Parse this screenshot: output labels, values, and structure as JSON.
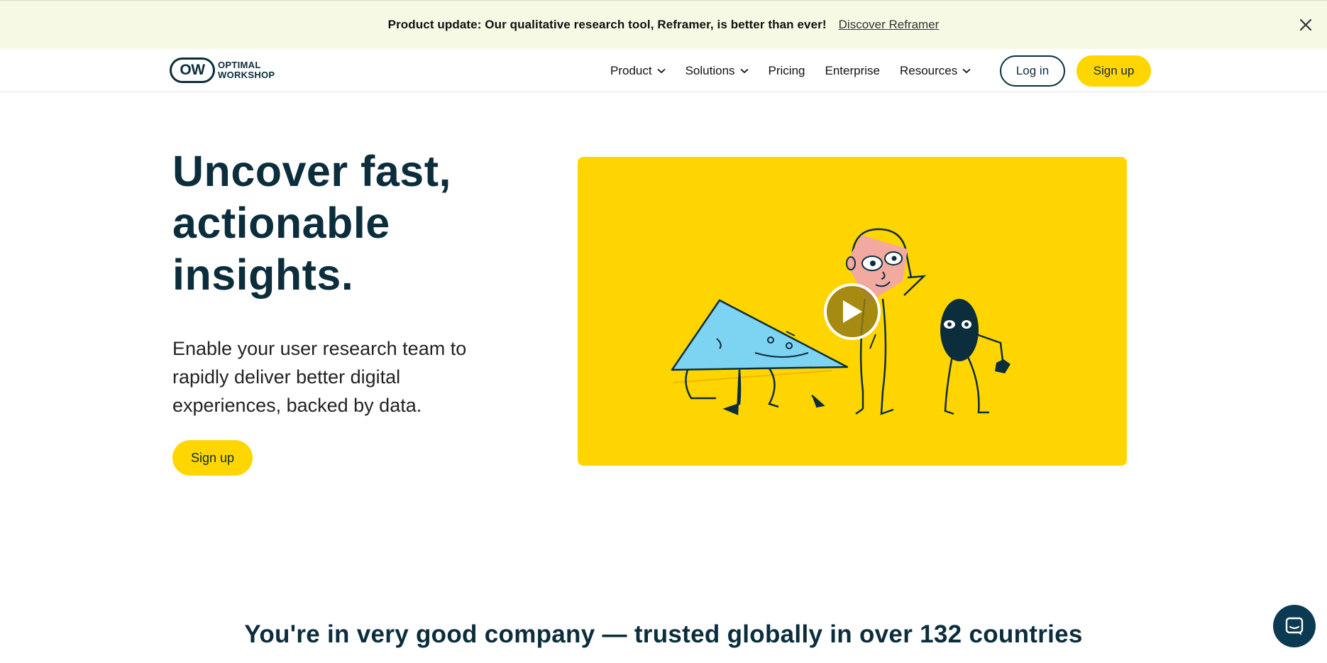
{
  "banner": {
    "message": "Product update: Our qualitative research tool, Reframer, is better than ever!",
    "link_text": "Discover Reframer",
    "close_icon": "close-icon"
  },
  "nav": {
    "logo_mark": "OW",
    "logo_line1": "OPTIMAL",
    "logo_line2": "WORKSHOP",
    "links": [
      {
        "label": "Product",
        "has_dropdown": true
      },
      {
        "label": "Solutions",
        "has_dropdown": true
      },
      {
        "label": "Pricing",
        "has_dropdown": false
      },
      {
        "label": "Enterprise",
        "has_dropdown": false
      },
      {
        "label": "Resources",
        "has_dropdown": true
      }
    ],
    "login_label": "Log in",
    "signup_label": "Sign up"
  },
  "hero": {
    "title_line1": "Uncover fast,",
    "title_line2": "actionable",
    "title_line3": "insights.",
    "subtitle": "Enable your user research team to rapidly deliver better digital experiences, backed by data.",
    "signup_label": "Sign up",
    "play_icon": "play-icon"
  },
  "trusted": {
    "heading": "You're in very good company — trusted globally in over 132 countries"
  },
  "colors": {
    "brand_navy": "#0b2d3c",
    "accent_yellow": "#ffd600",
    "banner_bg": "#f6f9e4"
  },
  "chat": {
    "icon": "chat-icon"
  }
}
